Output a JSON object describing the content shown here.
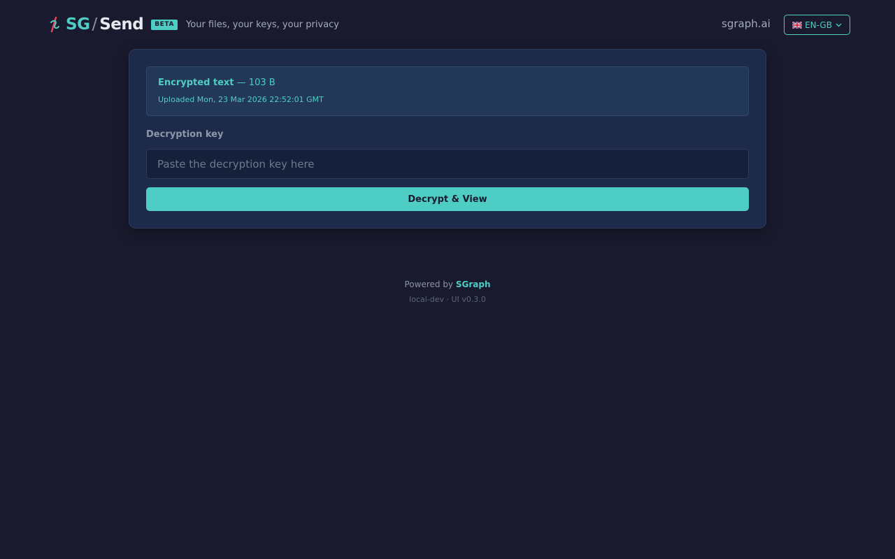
{
  "header": {
    "logo": {
      "sg": "SG",
      "slash": "/",
      "send": "Send"
    },
    "badge": "BETA",
    "tagline": "Your files, your keys, your privacy",
    "site_link": "sgraph.ai",
    "language": {
      "selected": "EN-GB",
      "flag_icon": "uk-flag-icon"
    }
  },
  "file_info": {
    "type_label": "Encrypted text",
    "size_text": " — 103 B",
    "uploaded": "Uploaded Mon, 23 Mar 2026 22:52:01 GMT"
  },
  "decryption": {
    "label": "Decryption key",
    "placeholder": "Paste the decryption key here",
    "value": "",
    "button_label": "Decrypt & View"
  },
  "footer": {
    "powered_prefix": "Powered by ",
    "brand": "SGraph",
    "version": "local-dev · UI v0.3.0"
  },
  "colors": {
    "background": "#1a1a2e",
    "accent": "#4ecdc4",
    "card": "#1e2a4a",
    "logo_mark_pink": "#e94560"
  }
}
